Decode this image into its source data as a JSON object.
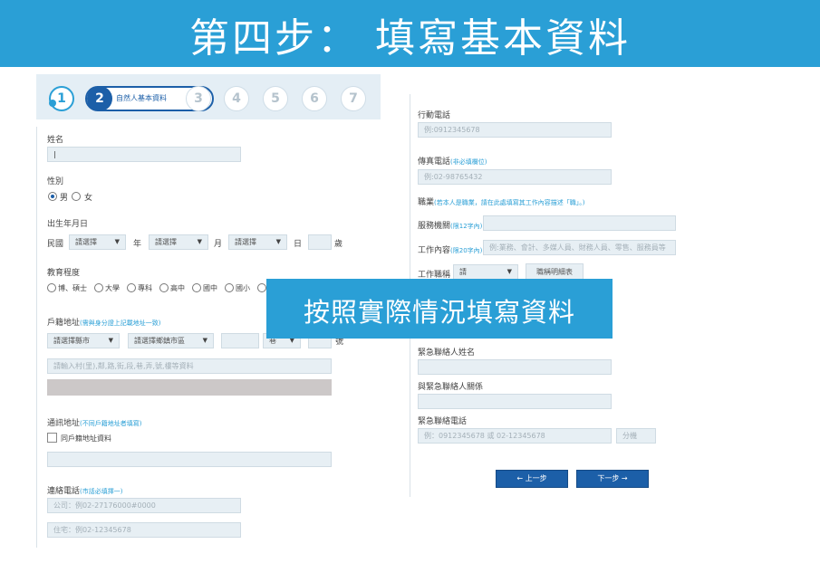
{
  "banner": {
    "title": "第四步：  填寫基本資料"
  },
  "steps": {
    "s1": "1",
    "s2": "2",
    "s2_label": "自然人基本資料",
    "s3": "3",
    "s4": "4",
    "s5": "5",
    "s6": "6",
    "s7": "7"
  },
  "left": {
    "name_label": "姓名",
    "gender_label": "性別",
    "male": "男",
    "female": "女",
    "birth_label": "出生年月日",
    "era": "民國",
    "year_placeholder": "請選擇",
    "year_unit": "年",
    "month_placeholder": "請選擇",
    "month_unit": "月",
    "day_placeholder": "請選擇",
    "day_unit": "日",
    "age_unit": "歲",
    "edu_label": "教育程度",
    "edu_options": [
      "博、碩士",
      "大學",
      "專科",
      "高中",
      "國中",
      "國小"
    ],
    "reg_addr_label": "戶籍地址",
    "reg_addr_hint": "(需與身分證上記載地址一致)",
    "city_placeholder": "請選擇縣市",
    "district_placeholder": "請選擇鄉鎮市區",
    "lane_unit": "巷",
    "no_unit": "號",
    "addr_placeholder": "請輸入村(里),鄰,路,街,段,巷,弄,號,樓等資料",
    "mail_addr_label": "通訊地址",
    "mail_addr_hint": "(不同戶籍地址者填寫)",
    "same_addr_label": "同戶籍地址資料",
    "phone_label": "連絡電話",
    "phone_hint": "(市話必填擇一)",
    "office_placeholder": "公司：例02-27176000#0000",
    "home_placeholder": "住宅：例02-12345678"
  },
  "right": {
    "mobile_label": "行動電話",
    "mobile_placeholder": "例:0912345678",
    "fax_label": "傳真電話",
    "fax_hint": "(非必填欄位)",
    "fax_placeholder": "例:02-98765432",
    "job_label": "職業",
    "job_hint": "(若本人是職業，請在此處填寫其工作內容描述「職」。)",
    "employer_label": "服務機關",
    "employer_hint": "(限12字內)",
    "work_label": "工作內容",
    "work_hint": "(限20字內)",
    "work_placeholder": "例:業務、會計、多媒人員、財務人員、零售、服務員等",
    "title_label": "工作職稱",
    "title_value": "請",
    "title_button": "職稱明細表",
    "emerg_name_label": "緊急聯絡人姓名",
    "emerg_rel_label": "與緊急聯絡人關係",
    "emerg_phone_label": "緊急聯絡電話",
    "emerg_phone_placeholder": "例：0912345678 或 02-12345678",
    "ext_placeholder": "分機",
    "prev_button": "←  上一步",
    "next_button": "下一步  →"
  },
  "overlay": {
    "text": "按照實際情況填寫資料"
  }
}
